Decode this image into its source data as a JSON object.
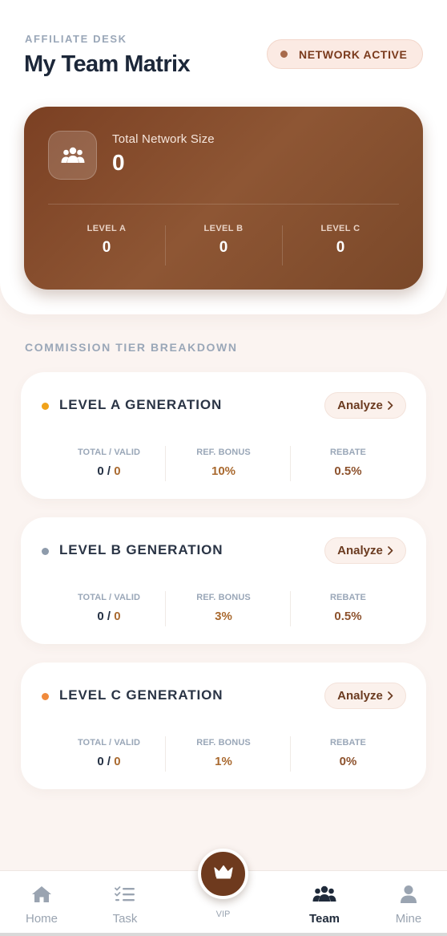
{
  "header": {
    "eyebrow": "AFFILIATE DESK",
    "title": "My Team Matrix",
    "status": "NETWORK ACTIVE"
  },
  "network": {
    "label": "Total Network Size",
    "value": "0",
    "levels": [
      {
        "label": "LEVEL A",
        "value": "0"
      },
      {
        "label": "LEVEL B",
        "value": "0"
      },
      {
        "label": "LEVEL C",
        "value": "0"
      }
    ]
  },
  "tiers": {
    "section_title": "COMMISSION TIER BREAKDOWN",
    "stat_labels": {
      "total_valid": "TOTAL / VALID",
      "ref_bonus": "REF. BONUS",
      "rebate": "REBATE"
    },
    "items": [
      {
        "name": "LEVEL A GENERATION",
        "dot_color": "#f0a21a",
        "analyze": "Analyze",
        "total": "0",
        "valid": "0",
        "ref_bonus": "10%",
        "rebate": "0.5%"
      },
      {
        "name": "LEVEL B GENERATION",
        "dot_color": "#8e9bab",
        "analyze": "Analyze",
        "total": "0",
        "valid": "0",
        "ref_bonus": "3%",
        "rebate": "0.5%"
      },
      {
        "name": "LEVEL C GENERATION",
        "dot_color": "#f08a3c",
        "analyze": "Analyze",
        "total": "0",
        "valid": "0",
        "ref_bonus": "1%",
        "rebate": "0%"
      }
    ]
  },
  "nav": {
    "home": "Home",
    "task": "Task",
    "vip": "VIP",
    "team": "Team",
    "mine": "Mine",
    "active": "team"
  },
  "colors": {
    "accent_brown": "#7b4023",
    "background": "#fbf4f1"
  }
}
